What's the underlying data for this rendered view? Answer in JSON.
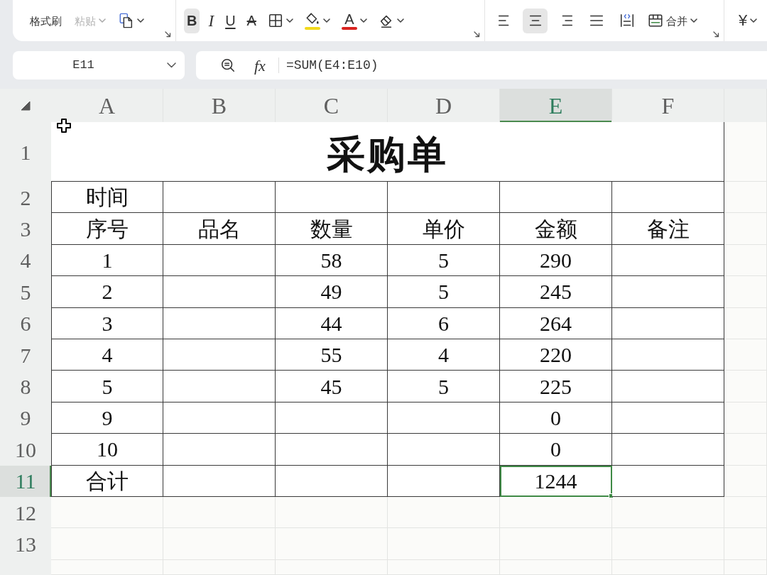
{
  "toolbar": {
    "groups": [
      {
        "launcher": true,
        "items": [
          {
            "kind": "format_painter",
            "label": "格式刷",
            "selected": false,
            "disabled": false,
            "dropdown": false
          },
          {
            "kind": "paste",
            "label": "粘贴",
            "selected": false,
            "disabled": true,
            "dropdown": true
          },
          {
            "kind": "copy",
            "selected": false,
            "disabled": false,
            "dropdown": true
          }
        ]
      },
      {
        "launcher": true,
        "items": [
          {
            "kind": "bold",
            "label": "B",
            "selected": true,
            "disabled": false,
            "dropdown": false
          },
          {
            "kind": "italic",
            "label": "I",
            "selected": false,
            "disabled": false,
            "dropdown": false
          },
          {
            "kind": "underline",
            "label": "U",
            "selected": false,
            "disabled": false,
            "dropdown": false
          },
          {
            "kind": "strikethrough",
            "label": "A",
            "selected": false,
            "disabled": false,
            "dropdown": false
          },
          {
            "kind": "borders",
            "selected": false,
            "disabled": false,
            "dropdown": true
          },
          {
            "kind": "fill_color",
            "color": "#f2d91c",
            "selected": false,
            "disabled": false,
            "dropdown": true
          },
          {
            "kind": "font_color",
            "label": "A",
            "color": "#d9231f",
            "selected": false,
            "disabled": false,
            "dropdown": true
          },
          {
            "kind": "clear",
            "selected": false,
            "disabled": false,
            "dropdown": true
          }
        ]
      },
      {
        "launcher": true,
        "items": [
          {
            "kind": "align_left",
            "selected": false,
            "disabled": false,
            "dropdown": false
          },
          {
            "kind": "align_center",
            "selected": true,
            "disabled": false,
            "dropdown": false
          },
          {
            "kind": "align_right",
            "selected": false,
            "disabled": false,
            "dropdown": false
          },
          {
            "kind": "justify",
            "selected": false,
            "disabled": false,
            "dropdown": false
          },
          {
            "kind": "distribute",
            "selected": false,
            "disabled": false,
            "dropdown": false
          },
          {
            "kind": "merge",
            "label": "合并",
            "selected": false,
            "disabled": false,
            "dropdown": true
          }
        ]
      },
      {
        "launcher": false,
        "items": [
          {
            "kind": "currency",
            "label": "¥",
            "selected": false,
            "disabled": false,
            "dropdown": true
          }
        ]
      }
    ]
  },
  "name_box": {
    "value": "E11"
  },
  "formula_bar": {
    "function_label": "fx",
    "value": "=SUM(E4:E10)"
  },
  "columns": [
    {
      "label": "A",
      "selected": false
    },
    {
      "label": "B",
      "selected": false
    },
    {
      "label": "C",
      "selected": false
    },
    {
      "label": "D",
      "selected": false
    },
    {
      "label": "E",
      "selected": true
    },
    {
      "label": "F",
      "selected": false
    }
  ],
  "rows": [
    {
      "number": "1",
      "kind": "title",
      "selected": false,
      "title": "采购单"
    },
    {
      "number": "2",
      "kind": "data",
      "selected": false,
      "cells": [
        {
          "text": "时间",
          "selected": false
        },
        {
          "selected": false
        },
        {
          "selected": false
        },
        {
          "selected": false
        },
        {
          "selected": false
        },
        {
          "selected": false
        }
      ]
    },
    {
      "number": "3",
      "kind": "data",
      "selected": false,
      "cells": [
        {
          "text": "序号",
          "selected": false
        },
        {
          "text": "品名",
          "selected": false
        },
        {
          "text": "数量",
          "selected": false
        },
        {
          "text": "单价",
          "selected": false
        },
        {
          "text": "金额",
          "selected": false
        },
        {
          "text": "备注",
          "selected": false
        }
      ]
    },
    {
      "number": "4",
      "kind": "data",
      "selected": false,
      "cells": [
        {
          "text": "1",
          "selected": false
        },
        {
          "selected": false
        },
        {
          "text": "58",
          "selected": false
        },
        {
          "text": "5",
          "selected": false
        },
        {
          "text": "290",
          "selected": false
        },
        {
          "selected": false
        }
      ]
    },
    {
      "number": "5",
      "kind": "data",
      "selected": false,
      "cells": [
        {
          "text": "2",
          "selected": false
        },
        {
          "selected": false
        },
        {
          "text": "49",
          "selected": false
        },
        {
          "text": "5",
          "selected": false
        },
        {
          "text": "245",
          "selected": false
        },
        {
          "selected": false
        }
      ]
    },
    {
      "number": "6",
      "kind": "data",
      "selected": false,
      "cells": [
        {
          "text": "3",
          "selected": false
        },
        {
          "selected": false
        },
        {
          "text": "44",
          "selected": false
        },
        {
          "text": "6",
          "selected": false
        },
        {
          "text": "264",
          "selected": false
        },
        {
          "selected": false
        }
      ]
    },
    {
      "number": "7",
      "kind": "data",
      "selected": false,
      "cells": [
        {
          "text": "4",
          "selected": false
        },
        {
          "selected": false
        },
        {
          "text": "55",
          "selected": false
        },
        {
          "text": "4",
          "selected": false
        },
        {
          "text": "220",
          "selected": false
        },
        {
          "selected": false
        }
      ]
    },
    {
      "number": "8",
      "kind": "data",
      "selected": false,
      "cells": [
        {
          "text": "5",
          "selected": false
        },
        {
          "selected": false
        },
        {
          "text": "45",
          "selected": false
        },
        {
          "text": "5",
          "selected": false
        },
        {
          "text": "225",
          "selected": false
        },
        {
          "selected": false
        }
      ]
    },
    {
      "number": "9",
      "kind": "data",
      "selected": false,
      "cells": [
        {
          "text": "9",
          "selected": false
        },
        {
          "selected": false
        },
        {
          "selected": false
        },
        {
          "selected": false
        },
        {
          "text": "0",
          "selected": false
        },
        {
          "selected": false
        }
      ]
    },
    {
      "number": "10",
      "kind": "data",
      "selected": false,
      "cells": [
        {
          "text": "10",
          "selected": false
        },
        {
          "selected": false
        },
        {
          "selected": false
        },
        {
          "selected": false
        },
        {
          "text": "0",
          "selected": false
        },
        {
          "selected": false
        }
      ]
    },
    {
      "number": "11",
      "kind": "data",
      "selected": true,
      "cells": [
        {
          "text": "合计",
          "selected": false
        },
        {
          "selected": false
        },
        {
          "selected": false
        },
        {
          "selected": false
        },
        {
          "text": "1244",
          "selected": true
        },
        {
          "selected": false
        }
      ]
    },
    {
      "number": "12",
      "kind": "blank",
      "selected": false
    },
    {
      "number": "13",
      "kind": "blank",
      "selected": false
    }
  ]
}
